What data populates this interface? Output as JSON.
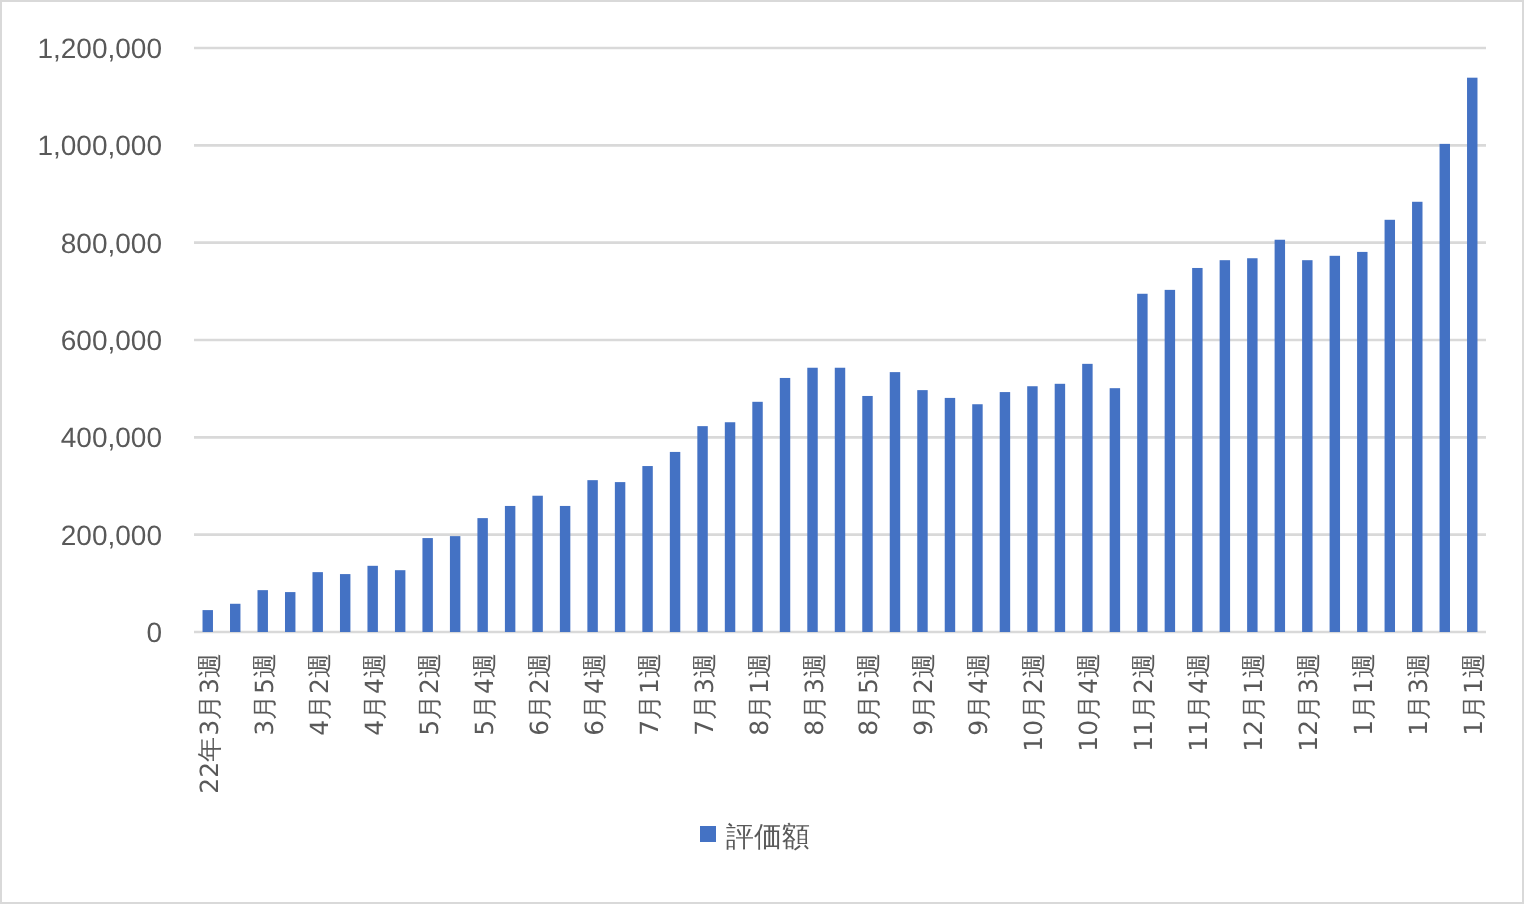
{
  "chart": {
    "chart_data": {
      "type": "bar",
      "orientation": "vertical",
      "categories": [
        "22年3月3週",
        null,
        "3月5週",
        null,
        "4月2週",
        null,
        "4月4週",
        null,
        "5月2週",
        null,
        "5月4週",
        null,
        "6月2週",
        null,
        "6月4週",
        null,
        "7月1週",
        null,
        "7月3週",
        null,
        "8月1週",
        null,
        "8月3週",
        null,
        "8月5週",
        null,
        "9月2週",
        null,
        "9月4週",
        null,
        "10月2週",
        null,
        "10月4週",
        null,
        "11月2週",
        null,
        "11月4週",
        null,
        "12月1週",
        null,
        "12月3週",
        null,
        "1月1週",
        null,
        "1月3週",
        null,
        "1月1週"
      ],
      "series": [
        {
          "name": "評価額",
          "color": "#4472c4",
          "values": [
            45000,
            58000,
            86000,
            82000,
            123000,
            119000,
            136000,
            127000,
            193000,
            197000,
            234000,
            259000,
            280000,
            259000,
            312000,
            308000,
            341000,
            370000,
            423000,
            431000,
            473000,
            522000,
            543000,
            543000,
            485000,
            534000,
            497000,
            481000,
            468000,
            493000,
            505000,
            510000,
            551000,
            501000,
            695000,
            703000,
            748000,
            764000,
            768000,
            806000,
            764000,
            773000,
            781000,
            847000,
            884000,
            1003000,
            1139000
          ]
        }
      ],
      "ylim": [
        0,
        1200000
      ],
      "grid": "y",
      "yticks": [
        {
          "value": 0,
          "label": "0"
        },
        {
          "value": 200000,
          "label": "200,000"
        },
        {
          "value": 400000,
          "label": "400,000"
        },
        {
          "value": 600000,
          "label": "600,000"
        },
        {
          "value": 800000,
          "label": "800,000"
        },
        {
          "value": 1000000,
          "label": "1,000,000"
        },
        {
          "value": 1200000,
          "label": "1,200,000"
        }
      ]
    }
  }
}
